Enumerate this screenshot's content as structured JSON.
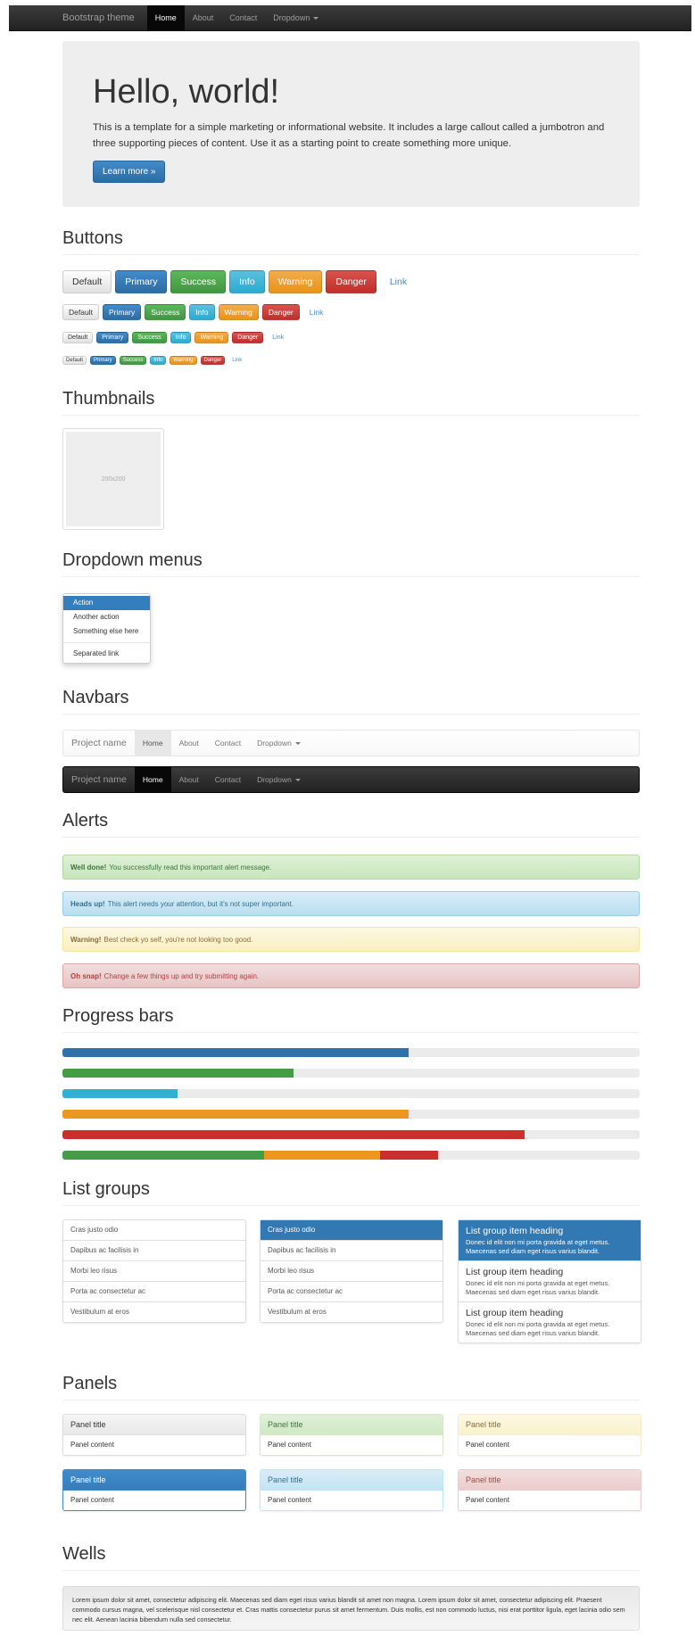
{
  "topbar": {
    "brand": "Bootstrap theme",
    "nav": [
      "Home",
      "About",
      "Contact",
      "Dropdown"
    ]
  },
  "jumbotron": {
    "title": "Hello, world!",
    "text": "This is a template for a simple marketing or informational website. It includes a large callout called a jumbotron and three supporting pieces of content. Use it as a starting point to create something more unique.",
    "button": "Learn more »"
  },
  "sections": {
    "buttons": "Buttons",
    "thumbnails": "Thumbnails",
    "dropdowns": "Dropdown menus",
    "navbars": "Navbars",
    "alerts": "Alerts",
    "progress": "Progress bars",
    "listgroups": "List groups",
    "panels": "Panels",
    "wells": "Wells"
  },
  "buttons": {
    "default": "Default",
    "primary": "Primary",
    "success": "Success",
    "info": "Info",
    "warning": "Warning",
    "danger": "Danger",
    "link": "Link"
  },
  "thumbnail": {
    "label": "200x200"
  },
  "dropdown": {
    "items": [
      "Action",
      "Another action",
      "Something else here"
    ],
    "separated": "Separated link"
  },
  "navbars": {
    "brand": "Project name",
    "nav": [
      "Home",
      "About",
      "Contact",
      "Dropdown"
    ]
  },
  "alerts": [
    {
      "strong": "Well done!",
      "text": "You successfully read this important alert message."
    },
    {
      "strong": "Heads up!",
      "text": "This alert needs your attention, but it's not super important."
    },
    {
      "strong": "Warning!",
      "text": "Best check yo self, you're not looking too good."
    },
    {
      "strong": "Oh snap!",
      "text": "Change a few things up and try submitting again."
    }
  ],
  "progress": {
    "primary": 60,
    "success": 40,
    "info": 20,
    "warning": 60,
    "danger": 80,
    "stacked": {
      "success": 35,
      "warning": 20,
      "danger": 10
    }
  },
  "listgroups": {
    "simple": [
      "Cras justo odio",
      "Dapibus ac facilisis in",
      "Morbi leo risus",
      "Porta ac consectetur ac",
      "Vestibulum at eros"
    ],
    "rich": {
      "heading": "List group item heading",
      "text": "Donec id elit non mi porta gravida at eget metus. Maecenas sed diam eget risus varius blandit."
    }
  },
  "panels": {
    "title": "Panel title",
    "content": "Panel content"
  },
  "colors": {
    "primary": "#428bca",
    "success": "#5cb85c",
    "info": "#5bc0de",
    "warning": "#f0ad4e",
    "danger": "#d9534f"
  },
  "well": {
    "text": "Lorem ipsum dolor sit amet, consectetur adipiscing elit. Maecenas sed diam eget risus varius blandit sit amet non magna. Lorem ipsum dolor sit amet, consectetur adipiscing elit. Praesent commodo cursus magna, vel scelerisque nisl consectetur et. Cras mattis consectetur purus sit amet fermentum. Duis mollis, est non commodo luctus, nisi erat porttitor ligula, eget lacinia odio sem nec elit. Aenean lacinia bibendum nulla sed consectetur."
  }
}
